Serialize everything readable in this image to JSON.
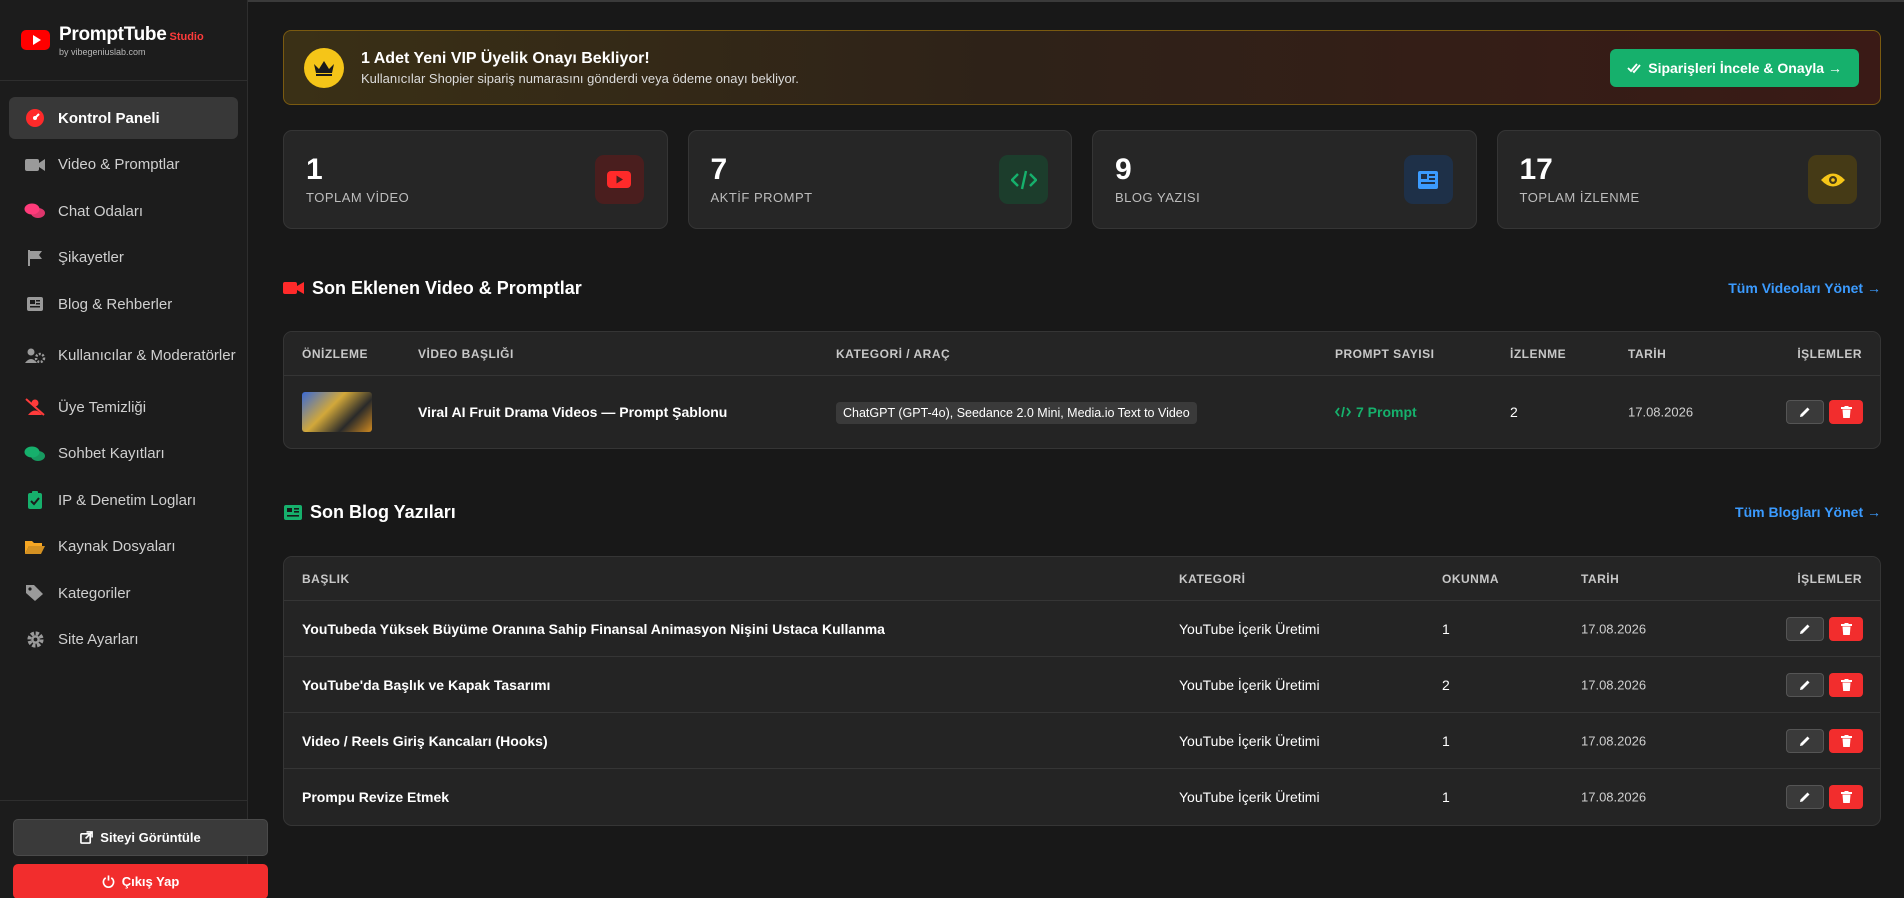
{
  "brand": {
    "name": "PromptTube",
    "studio": "Studio",
    "subtitle": "by vibegeniuslab.com"
  },
  "sidebar": {
    "items": [
      {
        "label": "Kontrol Paneli",
        "icon": "dashboard-icon",
        "color": "#ff2a2a"
      },
      {
        "label": "Video & Promptlar",
        "icon": "video-camera-icon",
        "color": "#9a9a9a"
      },
      {
        "label": "Chat Odaları",
        "icon": "chat-bubbles-icon",
        "color": "#ff3b7a"
      },
      {
        "label": "Şikayetler",
        "icon": "flag-icon",
        "color": "#9a9a9a"
      },
      {
        "label": "Blog & Rehberler",
        "icon": "newspaper-icon",
        "color": "#9a9a9a"
      },
      {
        "label": "Kullanıcılar & Moderatörler",
        "icon": "users-gear-icon",
        "color": "#9a9a9a"
      },
      {
        "label": "Üye Temizliği",
        "icon": "user-slash-icon",
        "color": "#ff3b3b"
      },
      {
        "label": "Sohbet Kayıtları",
        "icon": "comments-icon",
        "color": "#16b06c"
      },
      {
        "label": "IP & Denetim Logları",
        "icon": "clipboard-check-icon",
        "color": "#16b06c"
      },
      {
        "label": "Kaynak Dosyaları",
        "icon": "folder-open-icon",
        "color": "#f5a623"
      },
      {
        "label": "Kategoriler",
        "icon": "tags-icon",
        "color": "#9a9a9a"
      },
      {
        "label": "Site Ayarları",
        "icon": "gear-icon",
        "color": "#9a9a9a"
      }
    ],
    "view_site_label": "Siteyi Görüntüle",
    "logout_label": "Çıkış Yap"
  },
  "vip_banner": {
    "title": "1 Adet Yeni VIP Üyelik Onayı Bekliyor!",
    "subtitle": "Kullanıcılar Shopier sipariş numarasını gönderdi veya ödeme onayı bekliyor.",
    "button_label": "Siparişleri İncele & Onayla →"
  },
  "stats": [
    {
      "value": "1",
      "label": "TOPLAM VİDEO",
      "icon": "youtube-icon",
      "color": "#ff2a2a",
      "bg": "#4a1e1e"
    },
    {
      "value": "7",
      "label": "AKTİF PROMPT",
      "icon": "code-icon",
      "color": "#16b06c",
      "bg": "#1c3d2c"
    },
    {
      "value": "9",
      "label": "BLOG YAZISI",
      "icon": "newspaper-icon",
      "color": "#3b9bff",
      "bg": "#1e3048"
    },
    {
      "value": "17",
      "label": "TOPLAM İZLENME",
      "icon": "eye-icon",
      "color": "#f5c518",
      "bg": "#453a16"
    }
  ],
  "videos_section": {
    "title": "Son Eklenen Video & Promptlar",
    "link": "Tüm Videoları Yönet →",
    "columns": [
      "ÖNİZLEME",
      "VİDEO BAŞLIĞI",
      "KATEGORİ / ARAÇ",
      "PROMPT SAYISI",
      "İZLENME",
      "TARİH",
      "İŞLEMLER"
    ],
    "rows": [
      {
        "title": "Viral AI Fruit Drama Videos — Prompt Şablonu",
        "category": "ChatGPT (GPT-4o), Seedance 2.0 Mini, Media.io Text to Video",
        "prompts": "7 Prompt",
        "views": "2",
        "date": "17.08.2026"
      }
    ]
  },
  "blog_section": {
    "title": "Son Blog Yazıları",
    "link": "Tüm Blogları Yönet →",
    "columns": [
      "BAŞLIK",
      "KATEGORİ",
      "OKUNMA",
      "TARİH",
      "İŞLEMLER"
    ],
    "rows": [
      {
        "title": "YouTubeda Yüksek Büyüme Oranına Sahip Finansal Animasyon Nişini Ustaca Kullanma",
        "category": "YouTube İçerik Üretimi",
        "reads": "1",
        "date": "17.08.2026"
      },
      {
        "title": "YouTube'da Başlık ve Kapak Tasarımı",
        "category": "YouTube İçerik Üretimi",
        "reads": "2",
        "date": "17.08.2026"
      },
      {
        "title": "Video / Reels Giriş Kancaları (Hooks)",
        "category": "YouTube İçerik Üretimi",
        "reads": "1",
        "date": "17.08.2026"
      },
      {
        "title": "Prompu Revize Etmek",
        "category": "YouTube İçerik Üretimi",
        "reads": "1",
        "date": "17.08.2026"
      }
    ]
  }
}
